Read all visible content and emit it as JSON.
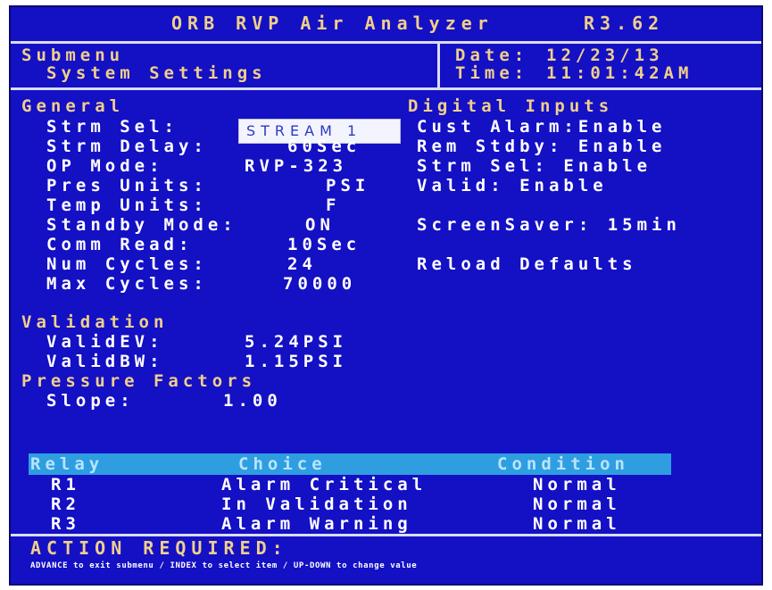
{
  "title": {
    "text": "ORB RVP Air Analyzer",
    "version": "R3.62"
  },
  "submenu": {
    "label": "Submenu",
    "value": "System Settings"
  },
  "datetime": {
    "date_label": "Date:",
    "date_value": "12/23/13",
    "time_label": "Time:",
    "time_value": "11:01:42AM"
  },
  "general": {
    "heading": "General",
    "items": [
      {
        "label": "Strm Sel:",
        "value": "STREAM 1"
      },
      {
        "label": "Strm Delay:",
        "value": "60Sec"
      },
      {
        "label": "OP Mode:",
        "value": "RVP-323"
      },
      {
        "label": "Pres Units:",
        "value": "PSI"
      },
      {
        "label": "Temp Units:",
        "value": "F"
      },
      {
        "label": "Standby Mode:",
        "value": "ON"
      },
      {
        "label": "Comm Read:",
        "value": "10Sec"
      },
      {
        "label": "Num Cycles:",
        "value": "24"
      },
      {
        "label": "Max Cycles:",
        "value": "70000"
      }
    ]
  },
  "digital_inputs": {
    "heading": "Digital Inputs",
    "items": [
      "Cust Alarm:Enable",
      "Rem Stdby: Enable",
      "Strm Sel: Enable",
      "Valid: Enable"
    ],
    "screensaver": "ScreenSaver: 15min",
    "reload": "Reload Defaults"
  },
  "validation": {
    "heading": "Validation",
    "items": [
      {
        "label": "ValidEV:",
        "value": "5.24PSI"
      },
      {
        "label": "ValidBW:",
        "value": "1.15PSI"
      }
    ]
  },
  "pressure": {
    "heading": "Pressure Factors",
    "items": [
      {
        "label": "Slope:",
        "value": "1.00"
      }
    ]
  },
  "relays": {
    "headers": [
      "Relay",
      "Choice",
      "Condition"
    ],
    "rows": [
      {
        "relay": "R1",
        "choice": "Alarm Critical",
        "condition": "Normal"
      },
      {
        "relay": "R2",
        "choice": "In Validation",
        "condition": "Normal"
      },
      {
        "relay": "R3",
        "choice": "Alarm Warning",
        "condition": "Normal"
      }
    ]
  },
  "action": {
    "heading": "ACTION REQUIRED:",
    "hint": "ADVANCE to exit submenu / INDEX to select item / UP-DOWN to change value"
  }
}
